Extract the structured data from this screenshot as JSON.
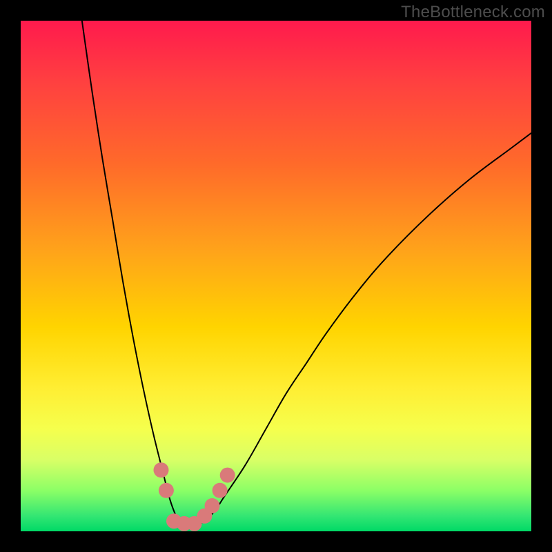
{
  "watermark": "TheBottleneck.com",
  "chart_data": {
    "type": "line",
    "title": "",
    "xlabel": "",
    "ylabel": "",
    "xlim": [
      0,
      100
    ],
    "ylim": [
      0,
      100
    ],
    "grid": false,
    "series": [
      {
        "name": "left-curve",
        "x": [
          12,
          14,
          16,
          18,
          20,
          22,
          24,
          26,
          28,
          29,
          30,
          31,
          32
        ],
        "y": [
          100,
          86,
          73,
          61,
          49,
          38,
          28,
          19,
          11,
          7,
          4,
          2,
          1
        ]
      },
      {
        "name": "right-curve",
        "x": [
          34,
          36,
          38,
          40,
          44,
          48,
          52,
          56,
          60,
          66,
          72,
          80,
          88,
          96,
          100
        ],
        "y": [
          1,
          2,
          4,
          7,
          13,
          20,
          27,
          33,
          39,
          47,
          54,
          62,
          69,
          75,
          78
        ]
      },
      {
        "name": "valley-floor",
        "x": [
          30,
          31,
          32,
          33,
          34,
          35,
          36
        ],
        "y": [
          3,
          2,
          1,
          1,
          1,
          2,
          3
        ]
      }
    ],
    "markers": [
      {
        "name": "left-marker-1",
        "x": 27.5,
        "y": 12
      },
      {
        "name": "left-marker-2",
        "x": 28.5,
        "y": 8
      },
      {
        "name": "floor-marker-1",
        "x": 30,
        "y": 2
      },
      {
        "name": "floor-marker-2",
        "x": 32,
        "y": 1.5
      },
      {
        "name": "floor-marker-3",
        "x": 34,
        "y": 1.5
      },
      {
        "name": "right-marker-1",
        "x": 36,
        "y": 3
      },
      {
        "name": "right-marker-2",
        "x": 37.5,
        "y": 5
      },
      {
        "name": "right-marker-3",
        "x": 39,
        "y": 8
      },
      {
        "name": "right-marker-4",
        "x": 40.5,
        "y": 11
      }
    ],
    "marker_color": "#d97a7a",
    "curve_color": "#000000"
  }
}
